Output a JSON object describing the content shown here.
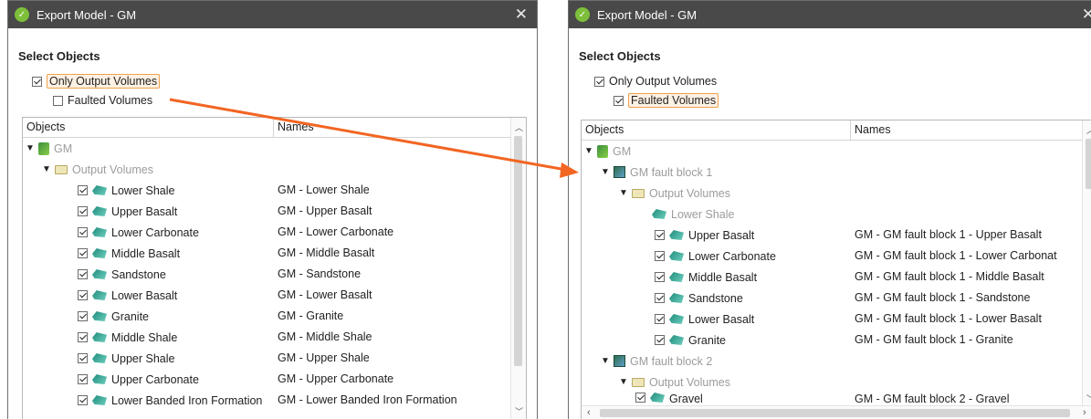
{
  "left": {
    "title": "Export Model - GM",
    "section_title": "Select Objects",
    "only_output_volumes": "Only Output Volumes",
    "faulted_volumes": "Faulted Volumes",
    "col_objects": "Objects",
    "col_names": "Names",
    "root": "GM",
    "folder": "Output Volumes",
    "volumes": [
      {
        "label": "Lower Shale",
        "name": "GM - Lower Shale"
      },
      {
        "label": "Upper Basalt",
        "name": "GM - Upper Basalt"
      },
      {
        "label": "Lower Carbonate",
        "name": "GM - Lower Carbonate"
      },
      {
        "label": "Middle Basalt",
        "name": "GM - Middle Basalt"
      },
      {
        "label": "Sandstone",
        "name": "GM - Sandstone"
      },
      {
        "label": "Lower Basalt",
        "name": "GM - Lower Basalt"
      },
      {
        "label": "Granite",
        "name": "GM - Granite"
      },
      {
        "label": "Middle Shale",
        "name": "GM - Middle Shale"
      },
      {
        "label": "Upper Shale",
        "name": "GM - Upper Shale"
      },
      {
        "label": "Upper Carbonate",
        "name": "GM - Upper Carbonate"
      },
      {
        "label": "Lower Banded Iron Formation",
        "name": "GM - Lower Banded Iron Formation"
      }
    ]
  },
  "right": {
    "title": "Export Model - GM",
    "section_title": "Select Objects",
    "only_output_volumes": "Only Output Volumes",
    "faulted_volumes": "Faulted Volumes",
    "col_objects": "Objects",
    "col_names": "Names",
    "root": "GM",
    "block1": "GM fault block 1",
    "folder1": "Output Volumes",
    "lower_shale": "Lower Shale",
    "volumes": [
      {
        "label": "Upper Basalt",
        "name": "GM - GM fault block 1 - Upper Basalt"
      },
      {
        "label": "Lower Carbonate",
        "name": "GM - GM fault block 1 - Lower Carbonat"
      },
      {
        "label": "Middle Basalt",
        "name": "GM - GM fault block 1 - Middle Basalt"
      },
      {
        "label": "Sandstone",
        "name": "GM - GM fault block 1 - Sandstone"
      },
      {
        "label": "Lower Basalt",
        "name": "GM - GM fault block 1 - Lower Basalt"
      },
      {
        "label": "Granite",
        "name": "GM - GM fault block 1 - Granite"
      }
    ],
    "block2": "GM fault block 2",
    "folder2": "Output Volumes",
    "partial_label": "Gravel",
    "partial_name": "GM - GM fault block 2 - Gravel"
  },
  "close_glyph": "✕",
  "app_glyph": "✓",
  "colors": {
    "titlebar": "#494949",
    "highlight": "#f0a04b",
    "arrow": "#f26522"
  }
}
